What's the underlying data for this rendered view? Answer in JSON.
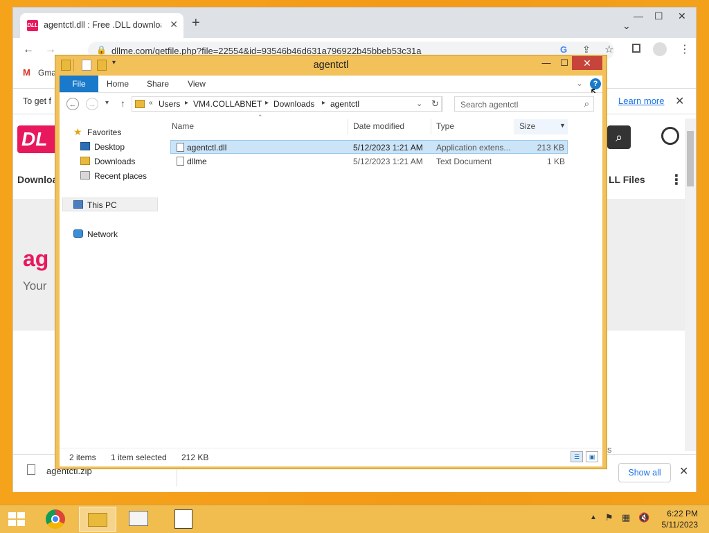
{
  "browser": {
    "tab_title": "agentctl.dll : Free .DLL download",
    "tab_favicon": "DLL",
    "url": "dllme.com/getfile.php?file=22554&id=93546b46d631a796922b45bbeb53c31a",
    "bookmark": "Gma",
    "infobar_text": "To get f",
    "learn_more": "Learn more",
    "site_logo": "DL",
    "site_nav_left": "Downloa",
    "site_nav_right": "LL Files",
    "heading_partial": "ag",
    "subheading_partial": "Your",
    "bottom_partial": "s",
    "download_item": "agentctl.zip",
    "show_all": "Show all"
  },
  "explorer": {
    "title": "agentctl",
    "ribbon_tabs": [
      "File",
      "Home",
      "Share",
      "View"
    ],
    "breadcrumb": [
      "Users",
      "VM4.COLLABNET",
      "Downloads",
      "agentctl"
    ],
    "breadcrumb_prefix": "«",
    "search_placeholder": "Search agentctl",
    "nav": {
      "favorites": "Favorites",
      "desktop": "Desktop",
      "downloads": "Downloads",
      "recent": "Recent places",
      "this_pc": "This PC",
      "network": "Network"
    },
    "columns": [
      "Name",
      "Date modified",
      "Type",
      "Size"
    ],
    "files": [
      {
        "name": "agentctl.dll",
        "date": "5/12/2023 1:21 AM",
        "type": "Application extens...",
        "size": "213 KB",
        "selected": true
      },
      {
        "name": "dllme",
        "date": "5/12/2023 1:21 AM",
        "type": "Text Document",
        "size": "1 KB",
        "selected": false
      }
    ],
    "status": {
      "count": "2 items",
      "selected": "1 item selected",
      "size": "212 KB"
    }
  },
  "taskbar": {
    "time": "6:22 PM",
    "date": "5/11/2023"
  },
  "colors": {
    "desktop": "#f6a31c",
    "explorer_frame": "#f2c15a",
    "close_button": "#c7443a",
    "file_tab": "#1979ca",
    "selection": "#cce4f7",
    "brand": "#e8185d"
  }
}
